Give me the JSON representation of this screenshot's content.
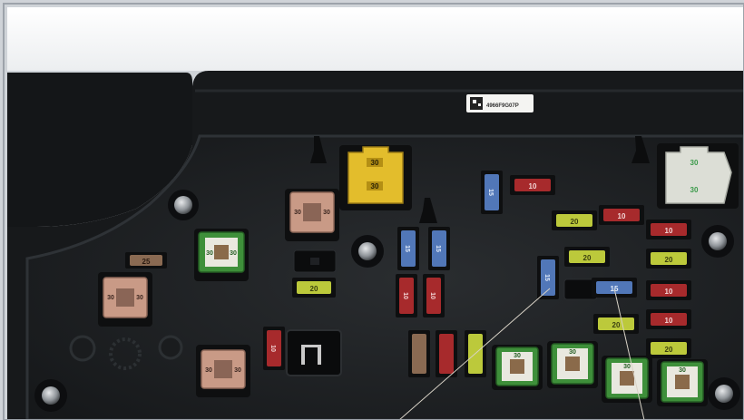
{
  "photo": {
    "sticker_text": "4966F9G07P",
    "relays": {
      "yellow": {
        "top": "30",
        "bottom": "30"
      },
      "white": {
        "top": "30",
        "bottom": "30"
      },
      "pink_top": {
        "top": "30",
        "bottom": "30"
      },
      "pink_left": {
        "top": "30",
        "bottom": "30"
      },
      "pink_bottom": {
        "top": "30",
        "bottom": "30"
      },
      "green_left": {
        "top": "30",
        "bottom": "30"
      },
      "green_row": [
        "30",
        "30",
        "30",
        "30"
      ]
    },
    "fuses": {
      "mini_tan_left": "25",
      "mini_yellow_left": "20",
      "mini_red_top": "10",
      "mini_yellow_r1": "20",
      "mini_red_r1": "10",
      "mini_yellow_r2": "20",
      "mini_red_col1": "10",
      "mini_yellow_col2": "20",
      "mini_red_col3": "10",
      "mini_blue_mid": "15",
      "mini_red_col4": "10",
      "mini_yellow_low": "20",
      "mini_yellow_bottom": "20",
      "tall_blue": "15",
      "tall_red": "10"
    },
    "colors": {
      "panel": "#1d2023",
      "yellow_relay": "#e3bd2c",
      "green_relay": "#3e8f3a",
      "pink_relay": "#c99a86",
      "blue_fuse": "#5177b8",
      "red_fuse": "#a72a2c",
      "yellow_fuse": "#bcc93b"
    }
  }
}
